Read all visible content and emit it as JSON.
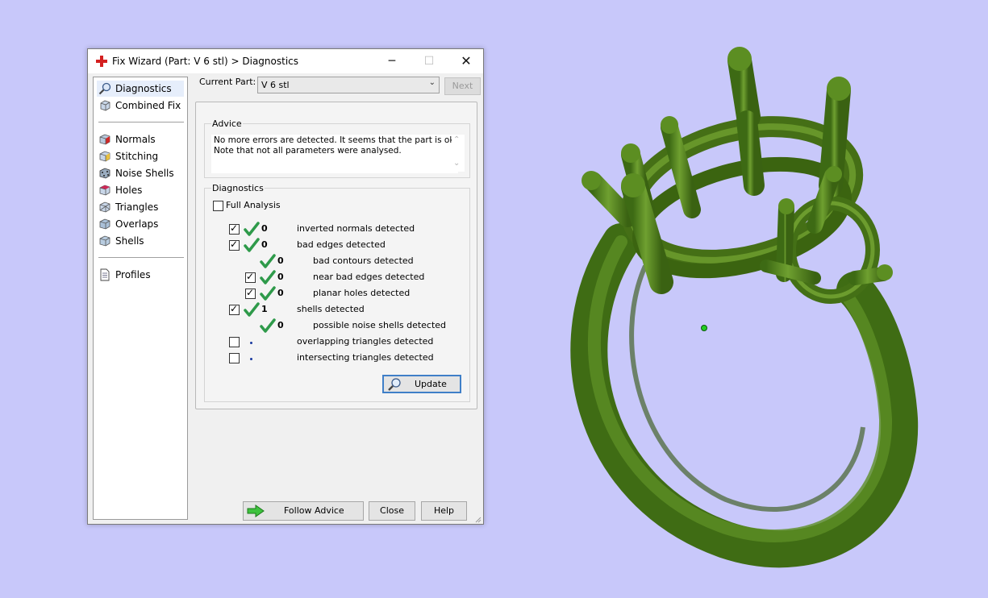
{
  "window": {
    "title": "Fix Wizard (Part: V 6 stl) > Diagnostics"
  },
  "nav": {
    "items": [
      {
        "label": "Diagnostics",
        "icon": "magnifier-icon"
      },
      {
        "label": "Combined Fix",
        "icon": "cube-icon"
      },
      {
        "label": "Normals",
        "icon": "normals-cube-icon"
      },
      {
        "label": "Stitching",
        "icon": "stitching-cube-icon"
      },
      {
        "label": "Noise Shells",
        "icon": "noise-shells-icon"
      },
      {
        "label": "Holes",
        "icon": "holes-cube-icon"
      },
      {
        "label": "Triangles",
        "icon": "triangles-cube-icon"
      },
      {
        "label": "Overlaps",
        "icon": "overlaps-cube-icon"
      },
      {
        "label": "Shells",
        "icon": "shells-cube-icon"
      },
      {
        "label": "Profiles",
        "icon": "profiles-document-icon"
      }
    ],
    "active": "Diagnostics"
  },
  "part": {
    "label": "Current Part:",
    "value": "V 6 stl",
    "next_label": "Next"
  },
  "advice": {
    "title": "Advice",
    "line1": "No more errors are detected. It seems that the part is ok.",
    "line2": "Note that not all parameters were analysed."
  },
  "diagnostics": {
    "title": "Diagnostics",
    "full_analysis_label": "Full Analysis",
    "rows": [
      {
        "count": "0",
        "label": "inverted normals detected",
        "checked": true,
        "status": "ok"
      },
      {
        "count": "0",
        "label": "bad edges detected",
        "checked": true,
        "status": "ok"
      },
      {
        "count": "0",
        "label": "bad contours detected",
        "checked": null,
        "status": "ok"
      },
      {
        "count": "0",
        "label": "near bad edges detected",
        "checked": true,
        "status": "ok"
      },
      {
        "count": "0",
        "label": "planar holes detected",
        "checked": true,
        "status": "ok"
      },
      {
        "count": "1",
        "label": "shells detected",
        "checked": true,
        "status": "ok"
      },
      {
        "count": "0",
        "label": "possible noise shells detected",
        "checked": null,
        "status": "ok"
      },
      {
        "count": "",
        "label": "overlapping triangles detected",
        "checked": false,
        "status": "not-analysed"
      },
      {
        "count": "",
        "label": "intersecting triangles detected",
        "checked": false,
        "status": "not-analysed"
      }
    ],
    "update_label": "Update"
  },
  "footer": {
    "follow_advice_label": "Follow Advice",
    "close_label": "Close",
    "help_label": "Help"
  },
  "colors": {
    "background": "#c8c8fa",
    "ring": "#4a7a18",
    "check_ok": "#2e9a4a",
    "focus_blue": "#3f7fc8"
  }
}
